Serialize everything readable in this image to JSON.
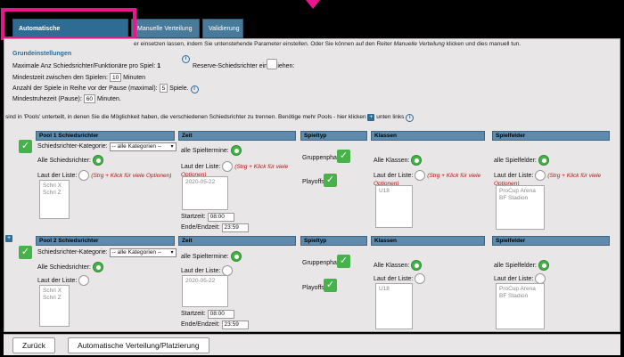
{
  "tabs": [
    {
      "label": "Automatische Verteilung/Platzierung"
    },
    {
      "label": "Manuelle Verteilung"
    },
    {
      "label": "Validierung"
    }
  ],
  "intro": {
    "text_a": "er einsetzen lassen, indem Sie untenstehende Parameter einstellen. Oder Sie können auf den Reiter ",
    "text_link": "Manuelle Verteilung",
    "text_b": " klicken und dies manuell tun."
  },
  "settings": {
    "heading": "Grundeinstellungen",
    "max_label": "Maximale Anz Schiedsrichter/Funktionäre pro Spiel:",
    "max_value": "1",
    "reserve_label": "Reserve-Schiedsrichter einbeziehen:",
    "mindest_label": "Mindestzeit zwischen den Spielen:",
    "mindest_value": "10",
    "mindest_unit": "Minuten",
    "reihe_label": "Anzahl der Spiele in Reihe vor der Pause (maximal):",
    "reihe_value": "5",
    "reihe_unit": "Spiele.",
    "ruhe_label": "Mindestruhezeit (Pause):",
    "ruhe_value": "60",
    "ruhe_unit": "Minuten."
  },
  "pools_text_a": "sind in 'Pools' unterteilt, in denen Sie die Möglichkeit haben, die verschiedenen Schiedsrichter zu trennen. Benötige mehr Pools - hier klicken",
  "pools_text_b": "unten links",
  "columns": {
    "zeit": "Zeit",
    "spieltyp": "Spieltyp",
    "klassen": "Klassen",
    "spielfelder": "Spielfelder"
  },
  "labels": {
    "kategorie": "Schiedsrichter-Kategorie:",
    "kategorie_value": "-- alle Kategorien --",
    "alle_sr": "Alle Schiedsrichter:",
    "laut_liste": "Laut der Liste:",
    "hint": "(Strg + Klick für viele Optionen)",
    "alle_spieltermine": "alle Spieltermine:",
    "laut_liste_hint": "(Strg + Klick für viele",
    "optionen": "Optionen)",
    "startzeit": "Startzeit:",
    "endzeit": "Ende/Endzeit:",
    "gruppenphase": "Gruppenphase:",
    "playoffs": "Playoffs:",
    "alle_klassen": "Alle Klassen:",
    "alle_spielfelder": "alle Spielfelder:"
  },
  "pools": [
    {
      "title": "Pool 1 Schiedsrichter",
      "refs": [
        "Schri X",
        "Schri Z"
      ],
      "date": "2020-05-22",
      "start": "08:00",
      "end": "23:59",
      "klasse": "U18",
      "felder": [
        "ProCup Arena",
        "BF Stadion"
      ]
    },
    {
      "title": "Pool 2 Schiedsrichter",
      "refs": [
        "Schri X",
        "Schri Z"
      ],
      "date": "2020-05-22",
      "start": "08:00",
      "end": "23:59",
      "klasse": "U18",
      "felder": [
        "ProCup Arena",
        "BF Stadion"
      ]
    }
  ],
  "footer": {
    "back": "Zurück",
    "auto": "Automatische Verteilung/Platzierung"
  },
  "colors": {
    "accent": "#e8158c",
    "tab": "#2f6c93",
    "header": "#5f8aab",
    "check": "#46b24a"
  }
}
